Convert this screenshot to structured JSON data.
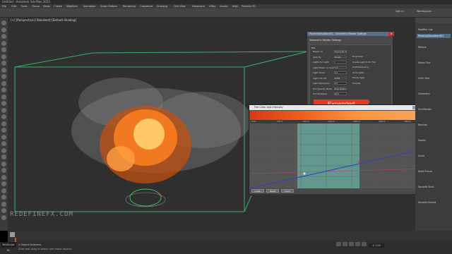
{
  "window": {
    "title": "Untitled - Autodesk 3ds Max 2023"
  },
  "menu": [
    "File",
    "Edit",
    "Tools",
    "Group",
    "Views",
    "Create",
    "Modifiers",
    "Animation",
    "Graph Editors",
    "Rendering",
    "Customize",
    "Scripting",
    "Civil View",
    "Substance",
    "V-Ray",
    "Arnold",
    "Help",
    "Phoenix FD"
  ],
  "toolbar": {
    "workspace_label": "Workspaces:",
    "workspace_value": "Default",
    "sign_in": "Sign in"
  },
  "viewport": {
    "label": "[+] [Perspective] [Standard] [Default Shading]"
  },
  "watermark": "REDEFINEFX.COM",
  "render_window": {
    "title": "PhoenixSimulator001 - Volumetric Render Settings",
    "tab": "Volumetric Render Settings",
    "group": "Fire",
    "rows": [
      {
        "label": "Based on",
        "value": "Temperature"
      },
      {
        "label": "Opacity",
        "value": "Simple"
      },
      {
        "label": "Lights for Light",
        "value": ""
      },
      {
        "label": "Light Power on Scene",
        "value": "1.0"
      },
      {
        "label": "Light Power",
        "value": "1.0"
      },
      {
        "label": "Light Cut-off",
        "value": "0.001"
      },
      {
        "label": "Light Resolution",
        "value": "0.5"
      },
      {
        "label": "Fire Opacity Mode",
        "value": "Fully Visible"
      },
      {
        "label": "Fire Multiplier",
        "value": "10.0"
      }
    ],
    "right_opts": [
      "Dropdown",
      "Create Light from Fire",
      "Self-Shadowing",
      "Grid Lights",
      "Decay Type",
      "Sample"
    ],
    "extra_note": "Average Grid Channels Color, and Intensity",
    "expanded_label": "Expanded"
  },
  "fire_window": {
    "title": "Fire Color and Intensity",
    "ruler": [
      "0.00",
      "500.0",
      "1000.0",
      "1500.0",
      "2000.0",
      "2500.0",
      "3000.0",
      "3500.0"
    ],
    "footer": [
      "Linear",
      "Reset",
      "Invert"
    ],
    "colors": {
      "highlight": "#70d0c0",
      "curve": "#3040c0"
    }
  },
  "right_panel": {
    "title": "Modifier List",
    "selected": "PhoenixSimulator001",
    "labels": [
      "Rollout",
      "Show Grid",
      "Grid: Size",
      "Geometry",
      "Sim/Render",
      "Bounds",
      "Voxels",
      "Scale",
      "Start Frame",
      "Smooth Start",
      "Smooth Extent"
    ]
  },
  "status": {
    "line1": "1 Object Selected",
    "line2": "Click and drag to select and move objects",
    "maxscript": "MAXScript Mi.",
    "frame": "0 / 100"
  }
}
